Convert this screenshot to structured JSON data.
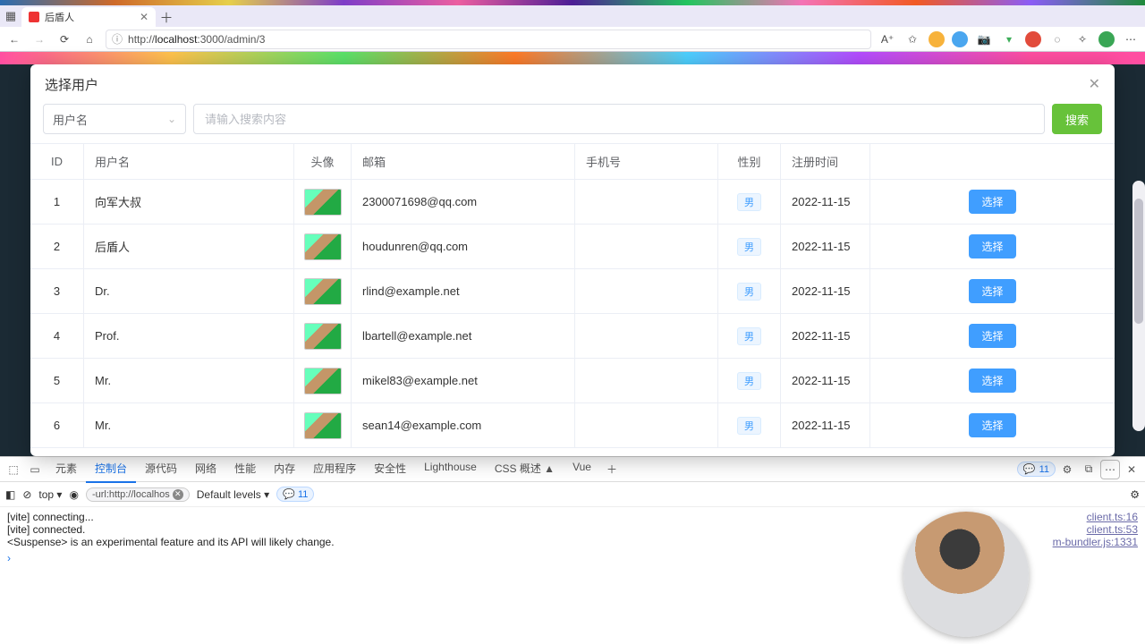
{
  "tab": {
    "title": "后盾人"
  },
  "addr": {
    "url_prefix": "http://",
    "url_bold": "localhost",
    "url_suffix": ":3000/admin/3"
  },
  "modal": {
    "title": "选择用户",
    "close": "✕",
    "search_field": "用户名",
    "search_placeholder": "请输入搜索内容",
    "search_btn": "搜索",
    "headers": {
      "id": "ID",
      "name": "用户名",
      "avatar": "头像",
      "email": "邮箱",
      "phone": "手机号",
      "gender": "性别",
      "created": "注册时间"
    },
    "action_label": "选择",
    "gender_tag": "男",
    "rows": [
      {
        "id": "1",
        "name": "向军大叔",
        "email": "2300071698@qq.com",
        "phone": "",
        "created": "2022-11-15"
      },
      {
        "id": "2",
        "name": "后盾人",
        "email": "houdunren@qq.com",
        "phone": "",
        "created": "2022-11-15"
      },
      {
        "id": "3",
        "name": "Dr.",
        "email": "rlind@example.net",
        "phone": "",
        "created": "2022-11-15"
      },
      {
        "id": "4",
        "name": "Prof.",
        "email": "lbartell@example.net",
        "phone": "",
        "created": "2022-11-15"
      },
      {
        "id": "5",
        "name": "Mr.",
        "email": "mikel83@example.net",
        "phone": "",
        "created": "2022-11-15"
      },
      {
        "id": "6",
        "name": "Mr.",
        "email": "sean14@example.com",
        "phone": "",
        "created": "2022-11-15"
      }
    ]
  },
  "devtools": {
    "tabs": [
      "元素",
      "控制台",
      "源代码",
      "网络",
      "性能",
      "内存",
      "应用程序",
      "安全性",
      "Lighthouse",
      "CSS 概述 ▲",
      "Vue"
    ],
    "active_tab": 1,
    "issue_count": "11",
    "toolbar": {
      "scope": "top",
      "filter": "-url:http://localhos",
      "levels": "Default levels",
      "count": "11"
    },
    "logs": [
      {
        "msg": "[vite] connecting...",
        "src": "client.ts:16"
      },
      {
        "msg": "[vite] connected.",
        "src": "client.ts:53"
      },
      {
        "msg": "<Suspense> is an experimental feature and its API will likely change.",
        "src": "m-bundler.js:1331"
      }
    ]
  }
}
